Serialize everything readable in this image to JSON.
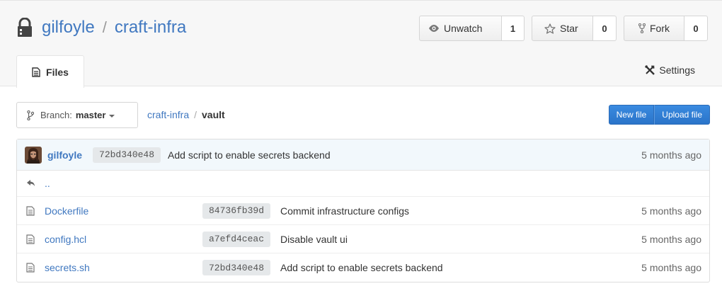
{
  "repo": {
    "owner": "gilfoyle",
    "separator": "/",
    "name": "craft-infra",
    "icon": "lock-icon"
  },
  "actions": {
    "watch": {
      "label": "Unwatch",
      "count": "1",
      "icon": "eye-icon"
    },
    "star": {
      "label": "Star",
      "count": "0",
      "icon": "star-icon"
    },
    "fork": {
      "label": "Fork",
      "count": "0",
      "icon": "fork-icon"
    }
  },
  "tabs": {
    "files": {
      "label": "Files",
      "icon": "file-icon"
    },
    "settings": {
      "label": "Settings",
      "icon": "tools-icon"
    }
  },
  "branch": {
    "prefix": "Branch:",
    "name": "master",
    "icon": "branch-icon"
  },
  "breadcrumb": {
    "root": "craft-infra",
    "separator": "/",
    "current": "vault"
  },
  "file_actions": {
    "new_file": "New file",
    "upload_file": "Upload file"
  },
  "latest_commit": {
    "author": "gilfoyle",
    "sha": "72bd340e48",
    "message": "Add script to enable secrets backend",
    "age": "5 months ago"
  },
  "up_dir": {
    "label": "..",
    "icon": "reply-icon"
  },
  "files": [
    {
      "name": "Dockerfile",
      "sha": "84736fb39d",
      "message": "Commit infrastructure configs",
      "age": "5 months ago",
      "icon": "file-text-icon"
    },
    {
      "name": "config.hcl",
      "sha": "a7efd4ceac",
      "message": "Disable vault ui",
      "age": "5 months ago",
      "icon": "file-text-icon"
    },
    {
      "name": "secrets.sh",
      "sha": "72bd340e48",
      "message": "Add script to enable secrets backend",
      "age": "5 months ago",
      "icon": "file-text-icon"
    }
  ],
  "colors": {
    "link": "#4078c0",
    "primary": "#2a74c9",
    "commit_bg": "#f2f8fc"
  }
}
